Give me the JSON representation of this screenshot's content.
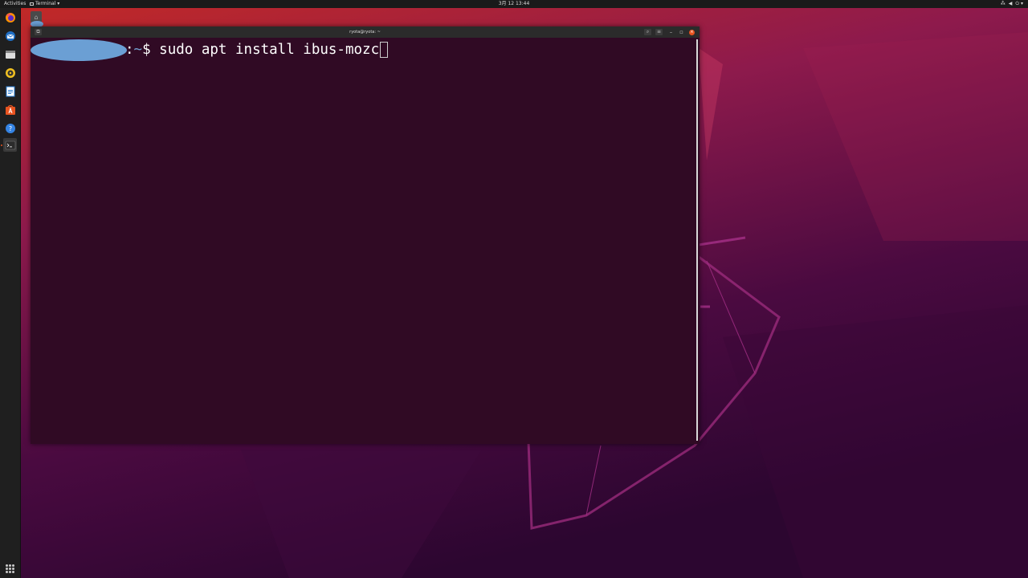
{
  "topbar": {
    "activities": "Activities",
    "app_menu": "Terminal ▾",
    "clock": "3月 12 13:44",
    "tray_network": "⁂",
    "tray_volume": "◀",
    "tray_power": "⏻ ▾"
  },
  "dock": {
    "items": [
      {
        "name": "firefox-icon"
      },
      {
        "name": "thunderbird-icon"
      },
      {
        "name": "files-icon"
      },
      {
        "name": "rhythmbox-icon"
      },
      {
        "name": "libreoffice-writer-icon"
      },
      {
        "name": "software-icon"
      },
      {
        "name": "help-icon"
      },
      {
        "name": "terminal-icon",
        "active": true
      }
    ]
  },
  "desktop": {
    "home_icon": "⌂"
  },
  "terminal": {
    "title": "ryota@ryota: ~",
    "newtab_icon": "⧉",
    "search_icon": "⌕",
    "menu_icon": "≡",
    "minimize_icon": "–",
    "maximize_icon": "▫",
    "close_icon": "×",
    "prompt_colon": ":",
    "prompt_path": "~",
    "prompt_dollar": "$ ",
    "command": "sudo apt install ibus-mozc"
  },
  "colors": {
    "terminal_bg": "#300a24",
    "accent": "#e95420",
    "path": "#729fcf"
  }
}
